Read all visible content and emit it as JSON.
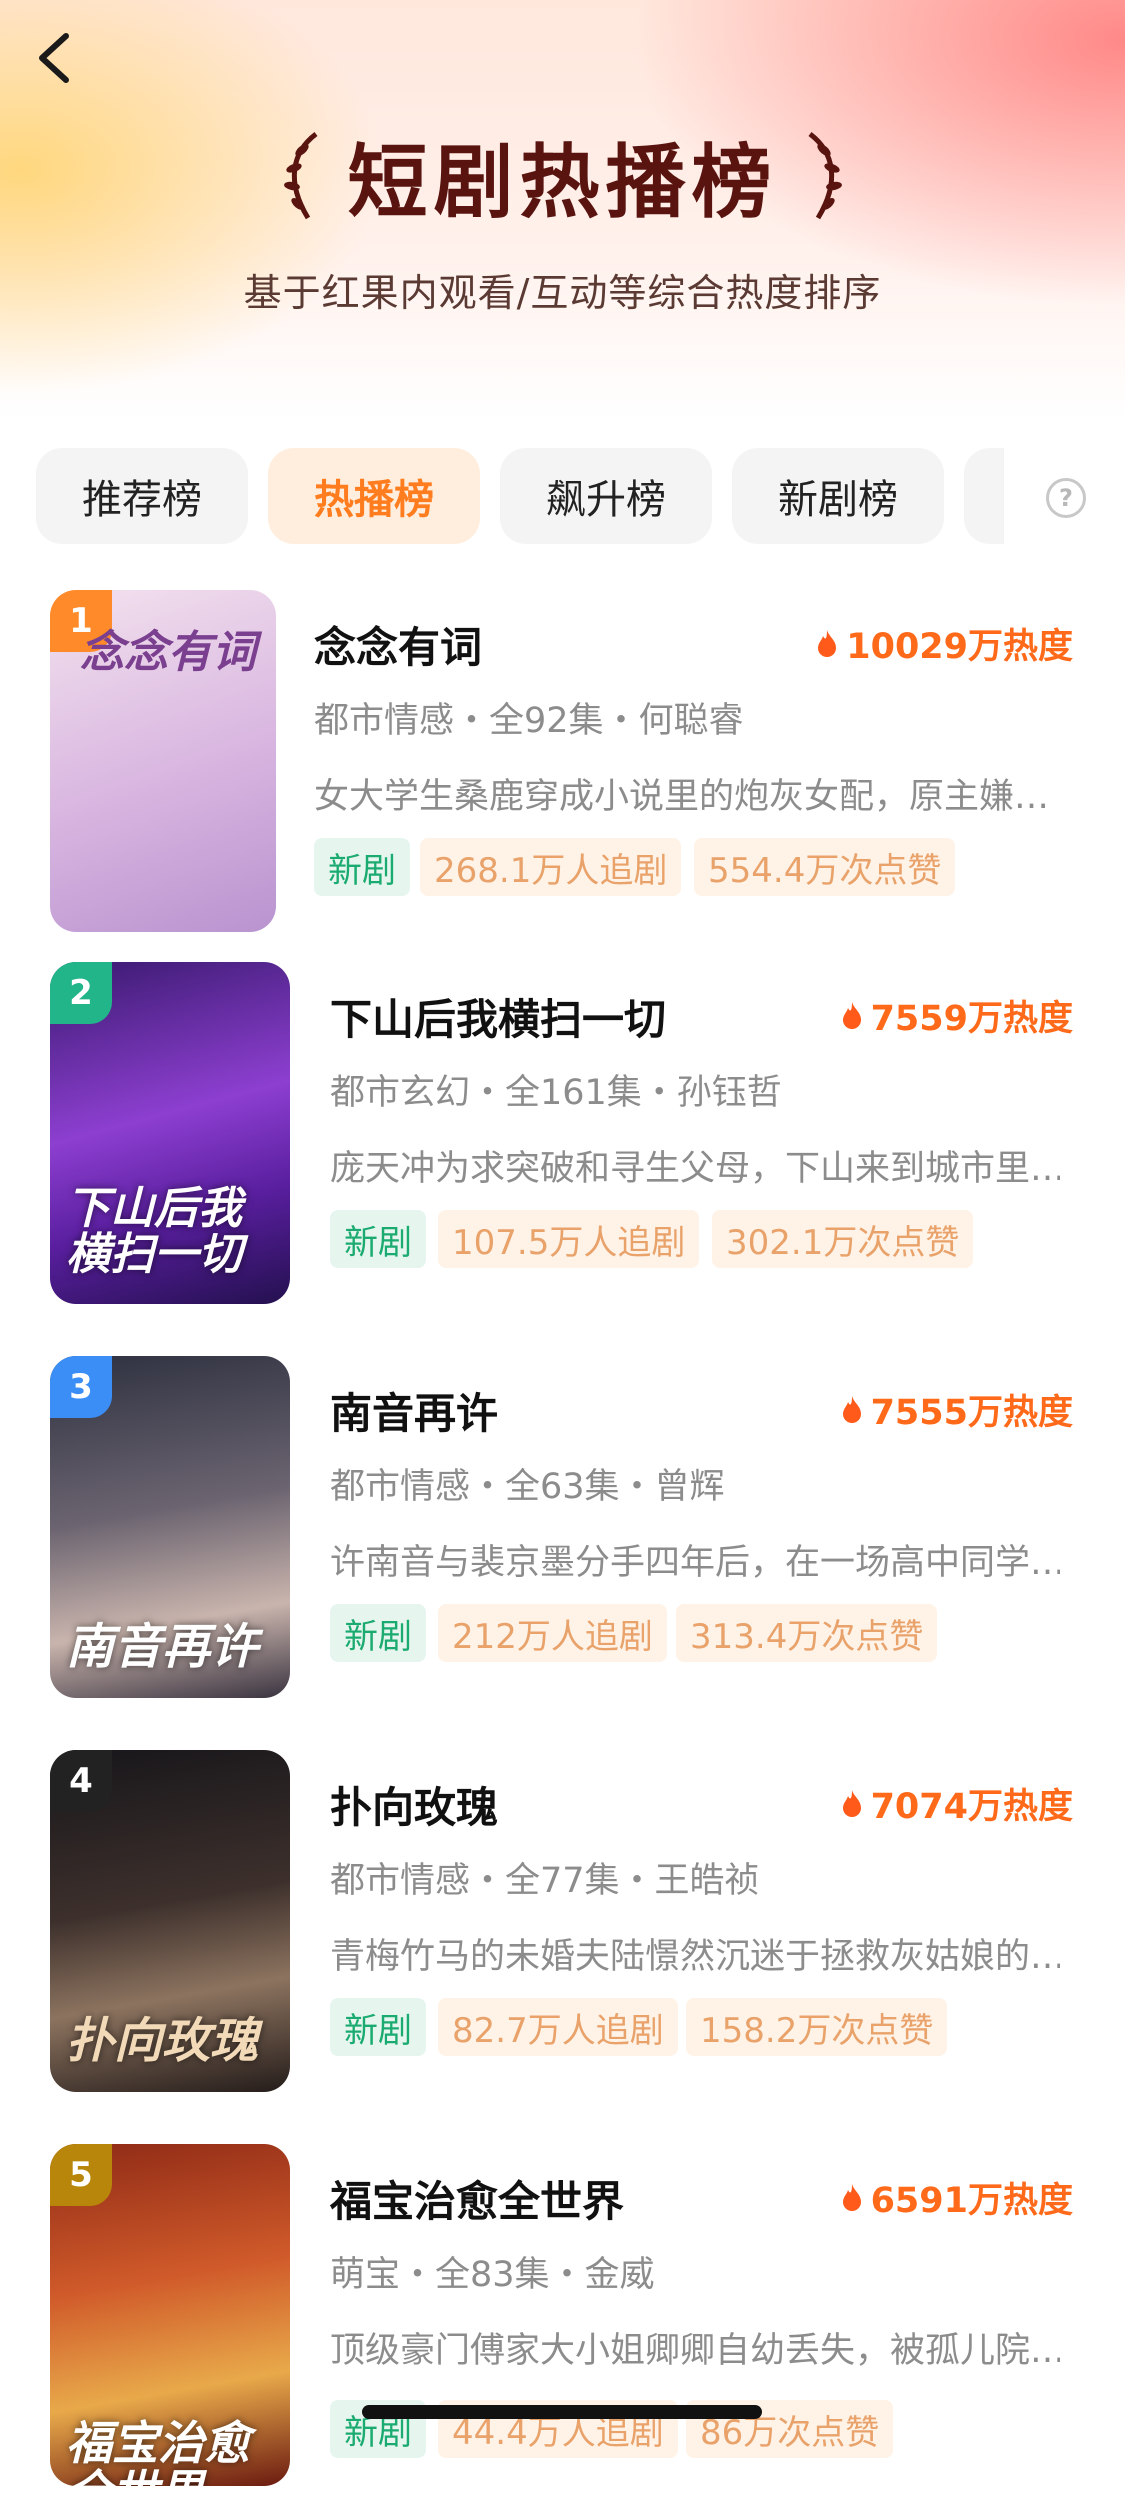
{
  "header": {
    "title": "短剧热播榜",
    "subtitle": "基于红果内观看/互动等综合热度排序"
  },
  "tabs": [
    {
      "label": "推荐榜",
      "active": false
    },
    {
      "label": "热播榜",
      "active": true
    },
    {
      "label": "飙升榜",
      "active": false
    },
    {
      "label": "新剧榜",
      "active": false
    }
  ],
  "items": [
    {
      "rank": "1",
      "name": "念念有词",
      "heat": "10029万热度",
      "meta": "都市情感・全92集・何聪睿",
      "desc": "女大学生桑鹿穿成小说里的炮灰女配，原主嫌…",
      "tag_new": "新剧",
      "followers": "268.1万人追剧",
      "likes": "554.4万次点赞",
      "poster_text": "念念有词",
      "rank_color": "#ff8a2a",
      "poster_colors": [
        "#e9c7e6",
        "#c7a4d8",
        "#f3e2ee"
      ]
    },
    {
      "rank": "2",
      "name": "下山后我横扫一切",
      "heat": "7559万热度",
      "meta": "都市玄幻・全161集・孙钰哲",
      "desc": "庞天冲为求突破和寻生父母，下山来到城市里…",
      "tag_new": "新剧",
      "followers": "107.5万人追剧",
      "likes": "302.1万次点赞",
      "poster_text": "下山后我\n横扫一切",
      "rank_color": "#22b58a",
      "poster_colors": [
        "#6a2fa8",
        "#a14fd8",
        "#2a1260"
      ]
    },
    {
      "rank": "3",
      "name": "南音再许",
      "heat": "7555万热度",
      "meta": "都市情感・全63集・曾辉",
      "desc": "许南音与裴京墨分手四年后，在一场高中同学…",
      "tag_new": "新剧",
      "followers": "212万人追剧",
      "likes": "313.4万次点赞",
      "poster_text": "南音再许",
      "rank_color": "#3a8ef5",
      "poster_colors": [
        "#3b3f4c",
        "#8a7f86",
        "#d8c7c2"
      ]
    },
    {
      "rank": "4",
      "name": "扑向玫瑰",
      "heat": "7074万热度",
      "meta": "都市情感・全77集・王皓祯",
      "desc": "青梅竹马的未婚夫陆憬然沉迷于拯救灰姑娘的…",
      "tag_new": "新剧",
      "followers": "82.7万人追剧",
      "likes": "158.2万次点赞",
      "poster_text": "扑向玫瑰",
      "rank_color": "#222222",
      "poster_colors": [
        "#1e1a1b",
        "#4a3a35",
        "#a88d76"
      ]
    },
    {
      "rank": "5",
      "name": "福宝治愈全世界",
      "heat": "6591万热度",
      "meta": "萌宝・全83集・金威",
      "desc": "顶级豪门傅家大小姐卿卿自幼丢失，被孤儿院…",
      "tag_new": "新剧",
      "followers": "44.4万人追剧",
      "likes": "86万次点赞",
      "poster_text": "福宝治愈\n全世界",
      "rank_color": "#b8860b",
      "poster_colors": [
        "#b63a1e",
        "#e8a94a",
        "#7a1a10"
      ]
    }
  ]
}
